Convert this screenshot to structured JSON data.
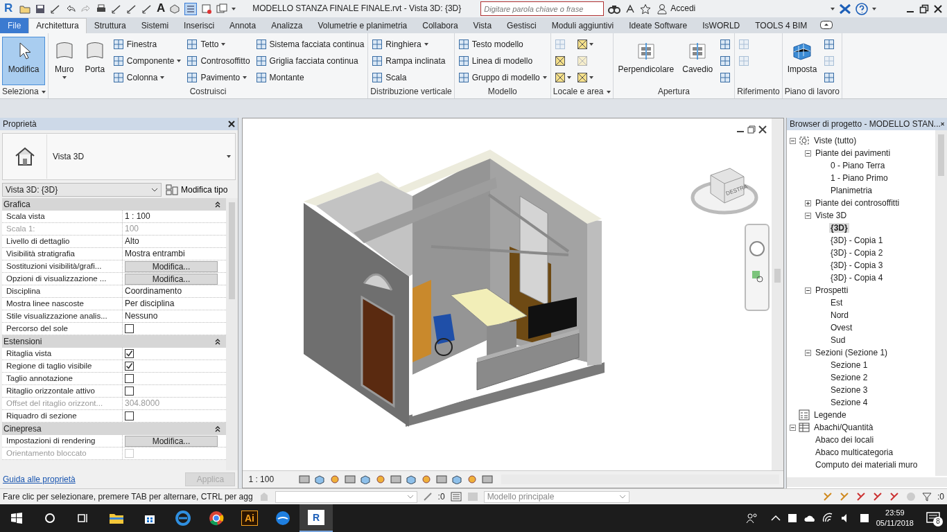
{
  "title_bar": {
    "app_logo": "R",
    "text_tool_glyph": "A",
    "title": "MODELLO STANZA FINALE FINALE.rvt - Vista 3D: {3D}",
    "search": {
      "placeholder": "Digitare parola chiave o frase"
    },
    "sign_in": "Accedi"
  },
  "tabs": [
    {
      "label": "File",
      "selected": false
    },
    {
      "label": "Architettura",
      "selected": true
    },
    {
      "label": "Struttura",
      "selected": false
    },
    {
      "label": "Sistemi",
      "selected": false
    },
    {
      "label": "Inserisci",
      "selected": false
    },
    {
      "label": "Annota",
      "selected": false
    },
    {
      "label": "Analizza",
      "selected": false
    },
    {
      "label": "Volumetrie e planimetria",
      "selected": false
    },
    {
      "label": "Collabora",
      "selected": false
    },
    {
      "label": "Vista",
      "selected": false
    },
    {
      "label": "Gestisci",
      "selected": false
    },
    {
      "label": "Moduli aggiuntivi",
      "selected": false
    },
    {
      "label": "Ideate Software",
      "selected": false
    },
    {
      "label": "IsWORLD",
      "selected": false
    },
    {
      "label": "TOOLS 4 BIM",
      "selected": false
    }
  ],
  "ribbon": {
    "panels": [
      {
        "title": "Seleziona",
        "dropdown": true,
        "columns": [
          [
            {
              "kind": "pointer",
              "label": "Modifica",
              "selected": true
            }
          ]
        ]
      },
      {
        "title": "Costruisci",
        "dropdown": false,
        "columns": [
          [
            {
              "kind": "large",
              "label": "Muro",
              "dropdown": true
            }
          ],
          [
            {
              "kind": "large",
              "label": "Porta",
              "dropdown": false
            }
          ],
          [
            {
              "kind": "small",
              "label": "Finestra",
              "dropdown": false
            },
            {
              "kind": "small",
              "label": "Componente",
              "dropdown": true
            },
            {
              "kind": "small",
              "label": "Colonna",
              "dropdown": true
            }
          ],
          [
            {
              "kind": "small",
              "label": "Tetto",
              "dropdown": true
            },
            {
              "kind": "small",
              "label": "Controsoffitto",
              "dropdown": false
            },
            {
              "kind": "small",
              "label": "Pavimento",
              "dropdown": true
            }
          ],
          [
            {
              "kind": "small",
              "label": "Sistema facciata continua",
              "dropdown": false
            },
            {
              "kind": "small",
              "label": "Griglia facciata continua",
              "dropdown": false
            },
            {
              "kind": "small",
              "label": "Montante",
              "dropdown": false
            }
          ]
        ]
      },
      {
        "title": "Distribuzione verticale",
        "dropdown": false,
        "columns": [
          [
            {
              "kind": "small",
              "label": "Ringhiera",
              "dropdown": true
            },
            {
              "kind": "small",
              "label": "Rampa inclinata",
              "dropdown": false
            },
            {
              "kind": "small",
              "label": "Scala",
              "dropdown": false
            }
          ]
        ]
      },
      {
        "title": "Modello",
        "dropdown": false,
        "columns": [
          [
            {
              "kind": "small",
              "label": "Testo modello",
              "dropdown": false
            },
            {
              "kind": "small",
              "label": "Linea di modello",
              "dropdown": false
            },
            {
              "kind": "small",
              "label": "Gruppo di modello",
              "dropdown": true
            }
          ]
        ]
      },
      {
        "title": "Locale e area",
        "dropdown": true,
        "columns": [
          [
            {
              "kind": "icon",
              "disabled": true,
              "dropdown": false
            },
            {
              "kind": "icon",
              "disabled": false,
              "dropdown": false
            },
            {
              "kind": "icon",
              "disabled": false,
              "dropdown": true
            }
          ],
          [
            {
              "kind": "icon",
              "disabled": false,
              "dropdown": true
            },
            {
              "kind": "icon",
              "disabled": true,
              "dropdown": false
            },
            {
              "kind": "icon",
              "disabled": false,
              "dropdown": true
            }
          ]
        ]
      },
      {
        "title": "Apertura",
        "dropdown": false,
        "columns": [
          [
            {
              "kind": "large",
              "label": "Perpendicolare",
              "dropdown": false
            }
          ],
          [
            {
              "kind": "large",
              "label": "Cavedio",
              "dropdown": false
            }
          ],
          [
            {
              "kind": "icon",
              "disabled": false,
              "dropdown": false
            },
            {
              "kind": "icon",
              "disabled": false,
              "dropdown": false
            },
            {
              "kind": "icon",
              "disabled": false,
              "dropdown": false
            }
          ]
        ]
      },
      {
        "title": "Riferimento",
        "dropdown": false,
        "columns": [
          [
            {
              "kind": "icon",
              "disabled": true,
              "dropdown": false
            },
            {
              "kind": "icon",
              "disabled": true,
              "dropdown": false
            }
          ]
        ]
      },
      {
        "title": "Piano di lavoro",
        "dropdown": false,
        "columns": [
          [
            {
              "kind": "large",
              "label": "Imposta",
              "dropdown": false
            }
          ],
          [
            {
              "kind": "icon",
              "disabled": false,
              "dropdown": false
            },
            {
              "kind": "icon",
              "disabled": true,
              "dropdown": false
            },
            {
              "kind": "icon",
              "disabled": false,
              "dropdown": false
            }
          ]
        ]
      }
    ]
  },
  "properties": {
    "title": "Proprietà",
    "type_name": "Vista 3D",
    "instance": "Vista 3D: {3D}",
    "edit_type": "Modifica tipo",
    "groups": [
      {
        "name": "Grafica",
        "rows": [
          {
            "label": "Scala vista",
            "kind": "text",
            "value": "1 : 100",
            "disabled": false
          },
          {
            "label": "Scala  1:",
            "kind": "text",
            "value": "100",
            "disabled": true
          },
          {
            "label": "Livello di dettaglio",
            "kind": "text",
            "value": "Alto",
            "disabled": false
          },
          {
            "label": "Visibilità stratigrafia",
            "kind": "text",
            "value": "Mostra entrambi",
            "disabled": false
          },
          {
            "label": "Sostituzioni visibilità/grafi...",
            "kind": "button",
            "value": "Modifica...",
            "disabled": false
          },
          {
            "label": "Opzioni di visualizzazione ...",
            "kind": "button",
            "value": "Modifica...",
            "disabled": false
          },
          {
            "label": "Disciplina",
            "kind": "text",
            "value": "Coordinamento",
            "disabled": false
          },
          {
            "label": "Mostra linee nascoste",
            "kind": "text",
            "value": "Per disciplina",
            "disabled": false
          },
          {
            "label": "Stile visualizzazione analis...",
            "kind": "text",
            "value": "Nessuno",
            "disabled": false
          },
          {
            "label": "Percorso del sole",
            "kind": "checkbox",
            "checked": false,
            "disabled": false
          }
        ]
      },
      {
        "name": "Estensioni",
        "rows": [
          {
            "label": "Ritaglia vista",
            "kind": "checkbox",
            "checked": true,
            "disabled": false
          },
          {
            "label": "Regione di taglio visibile",
            "kind": "checkbox",
            "checked": true,
            "disabled": false
          },
          {
            "label": "Taglio annotazione",
            "kind": "checkbox",
            "checked": false,
            "disabled": false
          },
          {
            "label": "Ritaglio orizzontale attivo",
            "kind": "checkbox",
            "checked": false,
            "disabled": false
          },
          {
            "label": "Offset del ritaglio orizzont...",
            "kind": "text",
            "value": "304.8000",
            "disabled": true
          },
          {
            "label": "Riquadro di sezione",
            "kind": "checkbox",
            "checked": false,
            "disabled": false
          }
        ]
      },
      {
        "name": "Cinepresa",
        "rows": [
          {
            "label": "Impostazioni di rendering",
            "kind": "button",
            "value": "Modifica...",
            "disabled": false
          },
          {
            "label": "Orientamento bloccato",
            "kind": "checkbox",
            "checked": false,
            "disabled": true
          }
        ]
      }
    ],
    "help_link": "Guida alle proprietà",
    "apply": "Applica"
  },
  "view": {
    "scale": "1 : 100",
    "view_cube_label": "DESTRA"
  },
  "browser": {
    "title": "Browser di progetto - MODELLO STAN...",
    "tree": [
      {
        "label": "Viste (tutto)",
        "kind": "views",
        "expanded": true,
        "selected": false,
        "children": [
          {
            "label": "Piante dei pavimenti",
            "expanded": true,
            "selected": false,
            "children": [
              {
                "label": "0 - Piano Terra",
                "selected": false
              },
              {
                "label": "1 - Piano Primo",
                "selected": false
              },
              {
                "label": "Planimetria",
                "selected": false
              }
            ]
          },
          {
            "label": "Piante dei controsoffitti",
            "expanded": false,
            "selected": false
          },
          {
            "label": "Viste 3D",
            "expanded": true,
            "selected": false,
            "children": [
              {
                "label": "{3D}",
                "selected": true
              },
              {
                "label": "{3D} - Copia 1",
                "selected": false
              },
              {
                "label": "{3D} - Copia 2",
                "selected": false
              },
              {
                "label": "{3D} - Copia 3",
                "selected": false
              },
              {
                "label": "{3D} - Copia 4",
                "selected": false
              }
            ]
          },
          {
            "label": "Prospetti",
            "expanded": true,
            "selected": false,
            "children": [
              {
                "label": "Est",
                "selected": false
              },
              {
                "label": "Nord",
                "selected": false
              },
              {
                "label": "Ovest",
                "selected": false
              },
              {
                "label": "Sud",
                "selected": false
              }
            ]
          },
          {
            "label": "Sezioni (Sezione 1)",
            "expanded": true,
            "selected": false,
            "children": [
              {
                "label": "Sezione 1",
                "selected": false
              },
              {
                "label": "Sezione 2",
                "selected": false
              },
              {
                "label": "Sezione 3",
                "selected": false
              },
              {
                "label": "Sezione 4",
                "selected": false
              }
            ]
          }
        ]
      },
      {
        "label": "Legende",
        "kind": "legend",
        "selected": false
      },
      {
        "label": "Abachi/Quantità",
        "kind": "schedule",
        "expanded": true,
        "selected": false,
        "children": [
          {
            "label": "Abaco dei locali",
            "selected": false
          },
          {
            "label": "Abaco multicategoria",
            "selected": false
          },
          {
            "label": "Computo dei materiali muro",
            "selected": false
          }
        ]
      }
    ]
  },
  "status_bar": {
    "message": "Fare clic per selezionare, premere TAB per alternare, CTRL per agg",
    "count": ":0",
    "model": "Modello principale",
    "filter_count": ":0"
  },
  "taskbar": {
    "apps": [
      {
        "kind": "folder",
        "selected": false
      },
      {
        "kind": "store",
        "selected": false
      },
      {
        "kind": "edge",
        "selected": false
      },
      {
        "kind": "chrome",
        "selected": false
      },
      {
        "kind": "illustrator",
        "label": "Ai",
        "selected": false
      },
      {
        "kind": "bird",
        "selected": false
      },
      {
        "kind": "revit",
        "label": "R",
        "selected": true
      }
    ],
    "time": "23:59",
    "date": "05/11/2018",
    "notifications": "8"
  }
}
